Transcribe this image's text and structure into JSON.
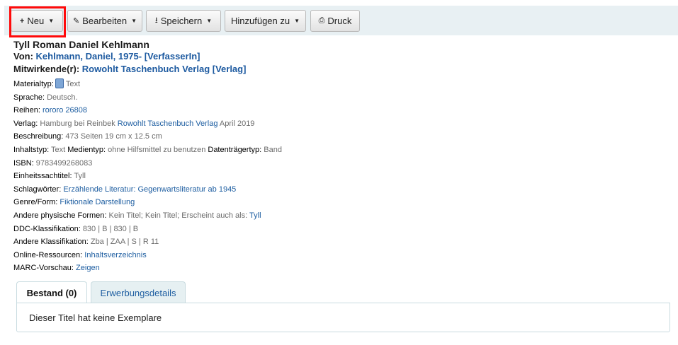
{
  "toolbar": {
    "new_label": "Neu",
    "edit_label": "Bearbeiten",
    "save_label": "Speichern",
    "add_to_label": "Hinzufügen zu",
    "print_label": "Druck"
  },
  "record": {
    "title": "Tyll Roman Daniel Kehlmann",
    "author_prefix": "Von:",
    "author_link": "Kehlmann, Daniel, 1975- [VerfasserIn]",
    "contributors_prefix": "Mitwirkende(r):",
    "contributors_link": "Rowohlt Taschenbuch Verlag [Verlag]",
    "material": {
      "label": "Materialtyp:",
      "value": "Text"
    },
    "language": {
      "label": "Sprache:",
      "value": "Deutsch."
    },
    "series": {
      "label": "Reihen:",
      "value": "rororo 26808"
    },
    "publisher": {
      "label": "Verlag:",
      "pre": "Hamburg bei Reinbek",
      "link": "Rowohlt Taschenbuch Verlag",
      "post": "April 2019"
    },
    "description": {
      "label": "Beschreibung:",
      "value": "473 Seiten 19 cm x 12.5 cm"
    },
    "content_type": {
      "label": "Inhaltstyp:",
      "value": "Text",
      "media_label": "Medientyp:",
      "media_value": "ohne Hilfsmittel zu benutzen",
      "carrier_label": "Datenträgertyp:",
      "carrier_value": "Band"
    },
    "isbn": {
      "label": "ISBN:",
      "value": "9783499268083"
    },
    "uniform_title": {
      "label": "Einheitssachtitel:",
      "value": "Tyll"
    },
    "subjects": {
      "label": "Schlagwörter:",
      "value": "Erzählende Literatur: Gegenwartsliteratur ab 1945"
    },
    "genre": {
      "label": "Genre/Form:",
      "value": "Fiktionale Darstellung"
    },
    "other_forms": {
      "label": "Andere physische Formen:",
      "value": "Kein Titel; Kein Titel; Erscheint auch als:",
      "link": "Tyll"
    },
    "ddc": {
      "label": "DDC-Klassifikation:",
      "value": "830 | B | 830 | B"
    },
    "other_class": {
      "label": "Andere Klassifikation:",
      "value": "Zba | ZAA | S | R 11"
    },
    "online": {
      "label": "Online-Ressourcen:",
      "value": "Inhaltsverzeichnis"
    },
    "marc": {
      "label": "MARC-Vorschau:",
      "value": "Zeigen"
    }
  },
  "tabs": {
    "holdings": "Bestand (0)",
    "acquisitions": "Erwerbungsdetails"
  },
  "panel": {
    "message": "Dieser Titel hat keine Exemplare"
  },
  "icons": {
    "new": "plus-icon",
    "edit": "pencil-icon",
    "save": "download-icon",
    "print": "print-icon",
    "material": "book-icon"
  },
  "colors": {
    "link": "#1e5ea1",
    "toolbar_bg": "#e8f0f3",
    "highlight": "#ff0a0a"
  }
}
